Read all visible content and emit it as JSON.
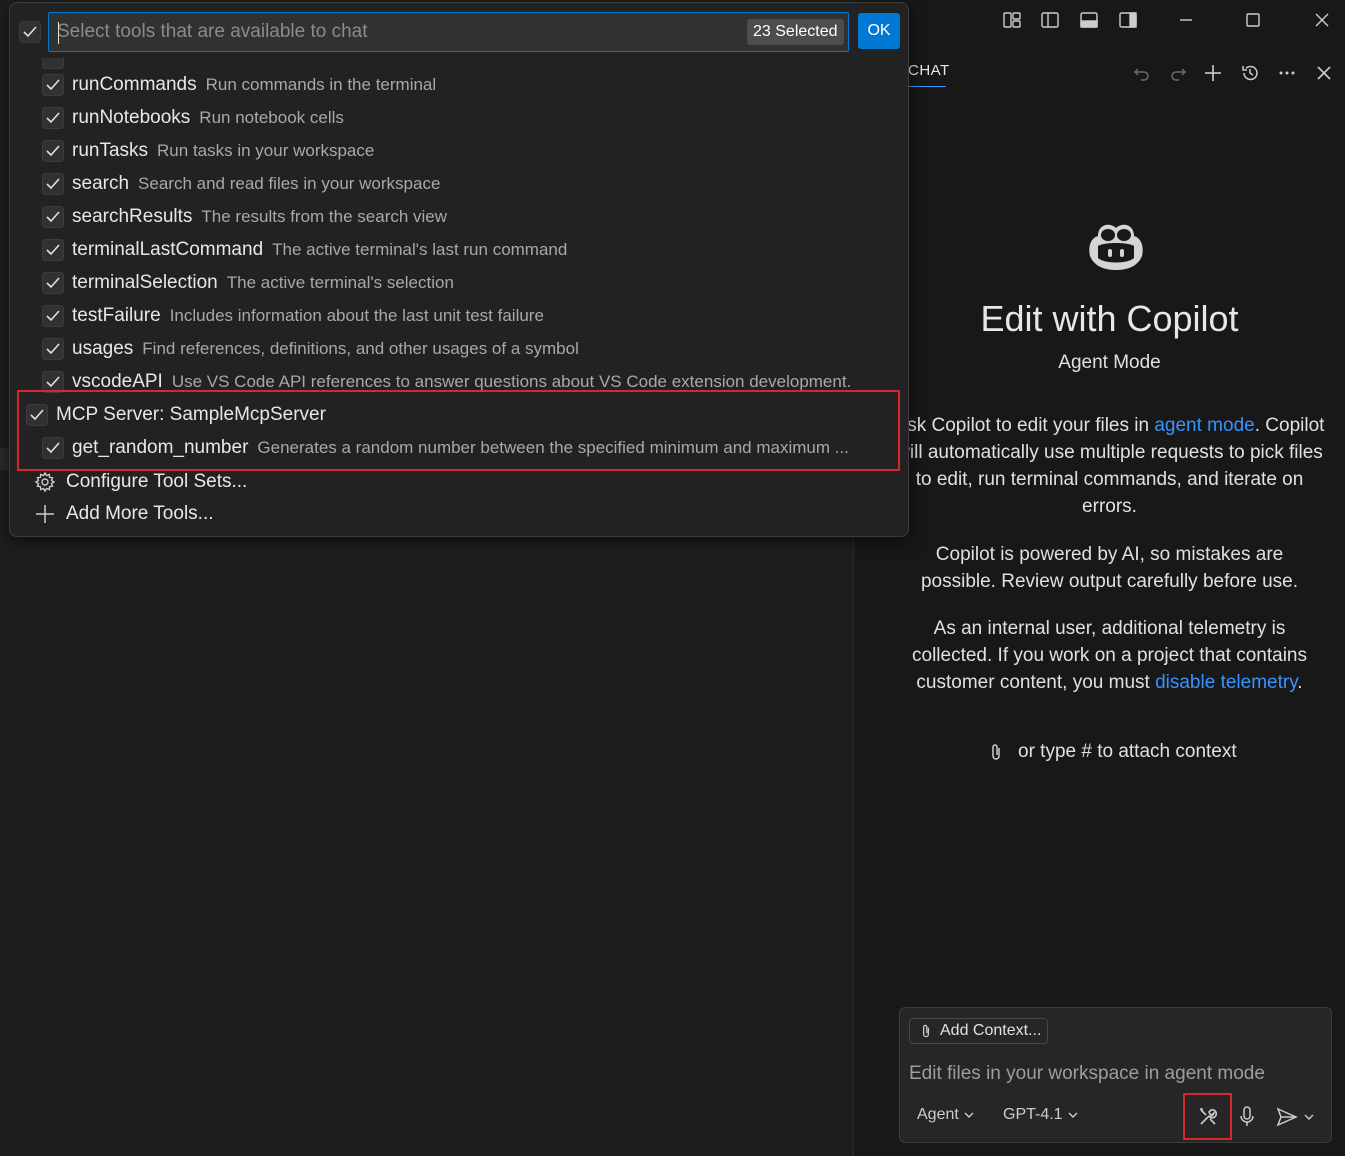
{
  "title_bar": {
    "icons": [
      "customize-layout-icon",
      "toggle-primary-sidebar-icon",
      "toggle-panel-icon",
      "toggle-secondary-sidebar-icon",
      "minimize-icon",
      "maximize-icon",
      "close-icon"
    ]
  },
  "quick_pick": {
    "placeholder": "Select tools that are available to chat",
    "selected_badge": "23 Selected",
    "ok_label": "OK",
    "tools": [
      {
        "name": "runCommands",
        "description": "Run commands in the terminal",
        "checked": true
      },
      {
        "name": "runNotebooks",
        "description": "Run notebook cells",
        "checked": true
      },
      {
        "name": "runTasks",
        "description": "Run tasks in your workspace",
        "checked": true
      },
      {
        "name": "search",
        "description": "Search and read files in your workspace",
        "checked": true
      },
      {
        "name": "searchResults",
        "description": "The results from the search view",
        "checked": true
      },
      {
        "name": "terminalLastCommand",
        "description": "The active terminal's last run command",
        "checked": true
      },
      {
        "name": "terminalSelection",
        "description": "The active terminal's selection",
        "checked": true
      },
      {
        "name": "testFailure",
        "description": "Includes information about the last unit test failure",
        "checked": true
      },
      {
        "name": "usages",
        "description": "Find references, definitions, and other usages of a symbol",
        "checked": true
      },
      {
        "name": "vscodeAPI",
        "description": "Use VS Code API references to answer questions about VS Code extension development.",
        "checked": true
      }
    ],
    "mcp_group": {
      "label": "MCP Server: SampleMcpServer",
      "checked": true,
      "tools": [
        {
          "name": "get_random_number",
          "description": "Generates a random number between the specified minimum and maximum ...",
          "checked": true
        }
      ]
    },
    "actions": [
      {
        "label": "Configure Tool Sets...",
        "icon": "gear-icon"
      },
      {
        "label": "Add More Tools...",
        "icon": "plus-icon"
      }
    ]
  },
  "chat": {
    "tab_label": "CHAT",
    "welcome_title": "Edit with Copilot",
    "welcome_subtitle": "Agent Mode",
    "para1": {
      "before_link": "Ask Copilot to edit your files in ",
      "link": "agent mode",
      "after_link": ". Copilot will automatically use multiple requests to pick files to edit, run terminal commands, and iterate on errors."
    },
    "para2": "Copilot is powered by AI, so mistakes are possible. Review output carefully before use.",
    "para3": {
      "before_link": "As an internal user, additional telemetry is collected. If you work on a project that contains customer content, you must ",
      "link": "disable telemetry",
      "after_link": "."
    },
    "attach_hint": "or type # to attach context",
    "add_context_label": "Add Context...",
    "input_placeholder": "Edit files in your workspace in agent mode",
    "mode_label": "Agent",
    "model_label": "GPT-4.1",
    "link_color": "#3794ff"
  }
}
